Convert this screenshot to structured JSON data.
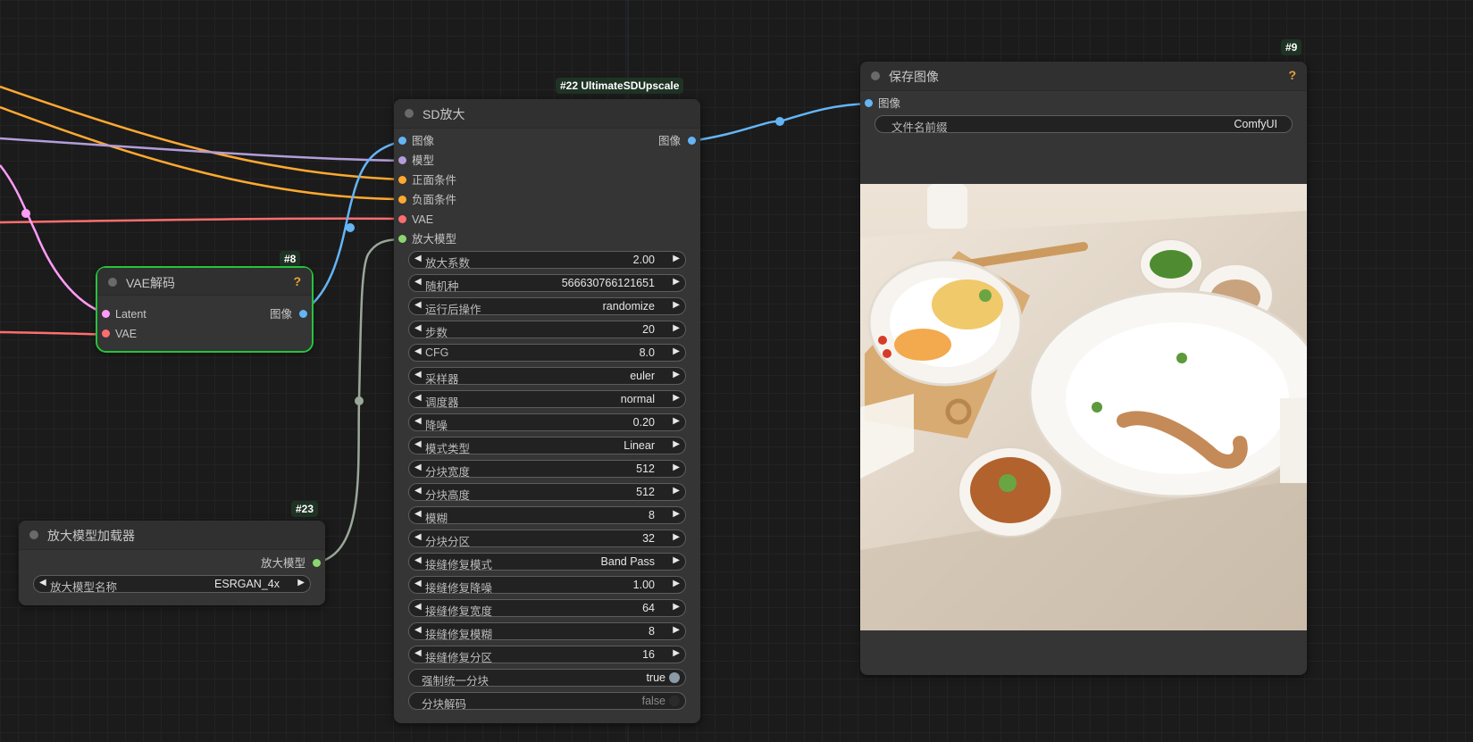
{
  "colors": {
    "image": "#64b5f6",
    "model": "#b39ddb",
    "conditioning": "#ffa931",
    "vae": "#ff6e6e",
    "latent": "#ff9cf9",
    "upscale_model": "#8cd66f",
    "selected_outline": "#26c43b"
  },
  "node_save": {
    "id": "#9",
    "title": "保存图像",
    "help": "?",
    "inputs": [
      {
        "label": "图像",
        "type": "image"
      }
    ],
    "widget_prefix": {
      "label": "文件名前缀",
      "value": "ComfyUI"
    },
    "preview_description_icon": "image-preview"
  },
  "node_upscale": {
    "id": "#22 UltimateSDUpscale",
    "title": "SD放大",
    "inputs": [
      {
        "label": "图像",
        "type": "image"
      },
      {
        "label": "模型",
        "type": "model"
      },
      {
        "label": "正面条件",
        "type": "conditioning"
      },
      {
        "label": "负面条件",
        "type": "conditioning"
      },
      {
        "label": "VAE",
        "type": "vae"
      },
      {
        "label": "放大模型",
        "type": "upscale_model"
      }
    ],
    "outputs": [
      {
        "label": "图像",
        "type": "image"
      }
    ],
    "widgets": [
      {
        "label": "放大系数",
        "value": "2.00"
      },
      {
        "label": "随机种",
        "value": "566630766121651"
      },
      {
        "label": "运行后操作",
        "value": "randomize"
      },
      {
        "label": "步数",
        "value": "20"
      },
      {
        "label": "CFG",
        "value": "8.0"
      },
      {
        "label": "采样器",
        "value": "euler"
      },
      {
        "label": "调度器",
        "value": "normal"
      },
      {
        "label": "降噪",
        "value": "0.20"
      },
      {
        "label": "模式类型",
        "value": "Linear"
      },
      {
        "label": "分块宽度",
        "value": "512"
      },
      {
        "label": "分块高度",
        "value": "512"
      },
      {
        "label": "模糊",
        "value": "8"
      },
      {
        "label": "分块分区",
        "value": "32"
      },
      {
        "label": "接缝修复模式",
        "value": "Band Pass"
      },
      {
        "label": "接缝修复降噪",
        "value": "1.00"
      },
      {
        "label": "接缝修复宽度",
        "value": "64"
      },
      {
        "label": "接缝修复模糊",
        "value": "8"
      },
      {
        "label": "接缝修复分区",
        "value": "16"
      }
    ],
    "toggles": [
      {
        "label": "强制统一分块",
        "value": "true",
        "on": true
      },
      {
        "label": "分块解码",
        "value": "false",
        "on": false
      }
    ]
  },
  "node_vae": {
    "id": "#8",
    "title": "VAE解码",
    "help": "?",
    "inputs": [
      {
        "label": "Latent",
        "type": "latent"
      },
      {
        "label": "VAE",
        "type": "vae"
      }
    ],
    "outputs": [
      {
        "label": "图像",
        "type": "image"
      }
    ]
  },
  "node_loader": {
    "id": "#23",
    "title": "放大模型加载器",
    "outputs": [
      {
        "label": "放大模型",
        "type": "upscale_model"
      }
    ],
    "widget_model": {
      "label": "放大模型名称",
      "value": "ESRGAN_4x"
    }
  }
}
